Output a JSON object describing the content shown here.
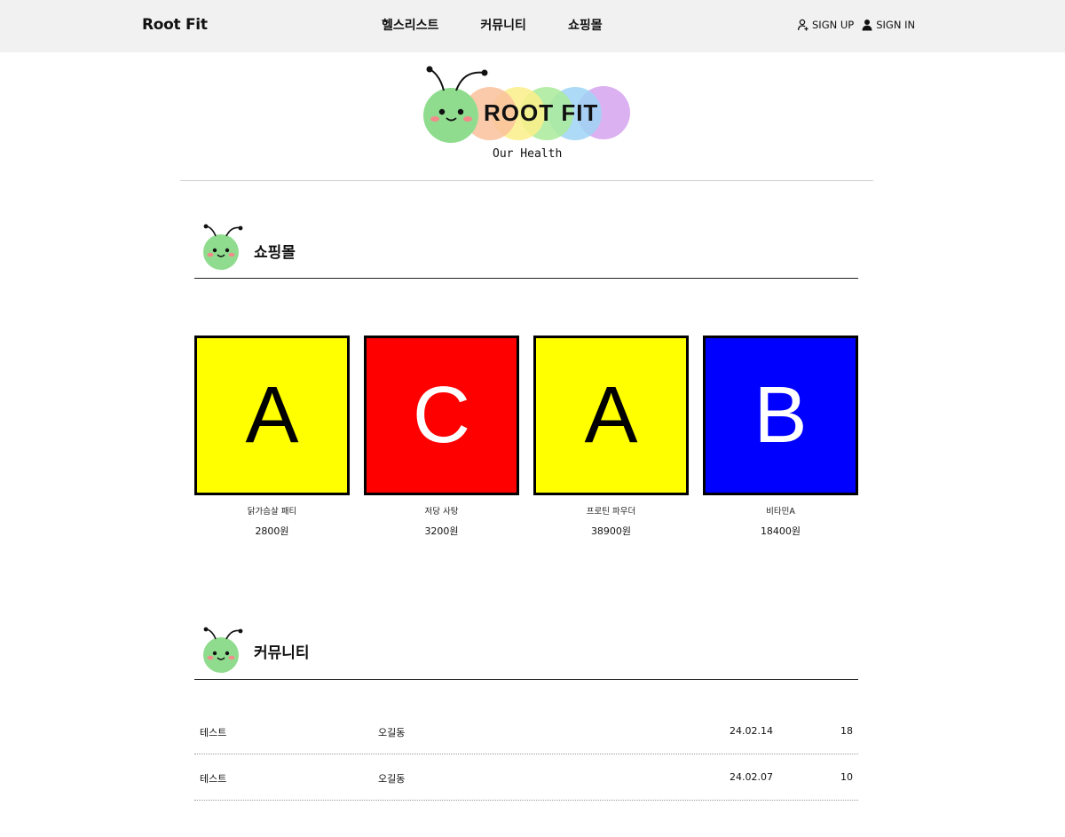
{
  "header": {
    "brand": "Root Fit",
    "nav": [
      "헬스리스트",
      "커뮤니티",
      "쇼핑몰"
    ],
    "sign_up": "SIGN UP",
    "sign_in": "SIGN IN"
  },
  "logo": {
    "title": "ROOT FIT",
    "tagline": "Our Health"
  },
  "shop": {
    "title": "쇼핑몰",
    "products": [
      {
        "letter": "A",
        "bg": "#ffff00",
        "fg": "#000000",
        "name": "닭가슴살 패티",
        "price": "2800원"
      },
      {
        "letter": "C",
        "bg": "#ff0000",
        "fg": "#ffffff",
        "name": "저당 사탕",
        "price": "3200원"
      },
      {
        "letter": "A",
        "bg": "#ffff00",
        "fg": "#000000",
        "name": "프로틴 파우더",
        "price": "38900원"
      },
      {
        "letter": "B",
        "bg": "#0000ff",
        "fg": "#ffffff",
        "name": "비타민A",
        "price": "18400원"
      }
    ]
  },
  "community": {
    "title": "커뮤니티",
    "posts": [
      {
        "title": "테스트",
        "author": "오길동",
        "date": "24.02.14",
        "views": "18"
      },
      {
        "title": "테스트",
        "author": "오길동",
        "date": "24.02.07",
        "views": "10"
      }
    ]
  }
}
